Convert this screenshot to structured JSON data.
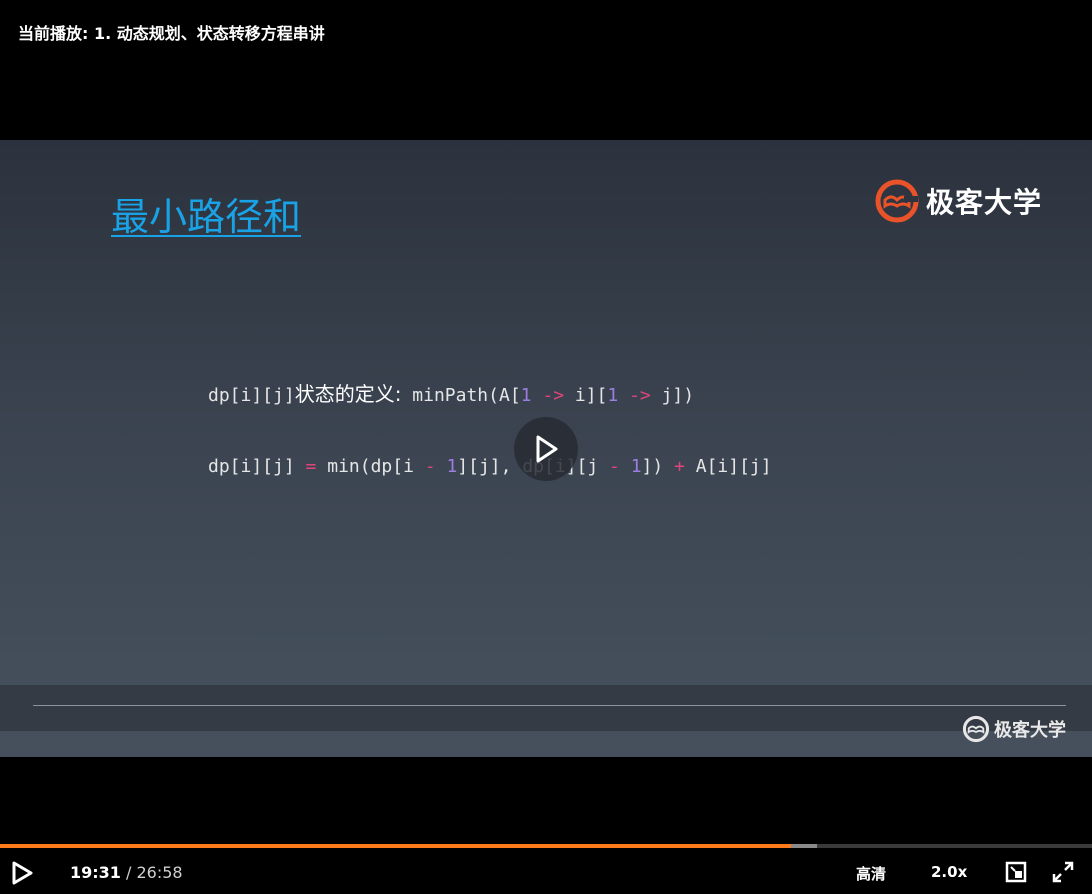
{
  "header": {
    "now_playing": "当前播放: 1. 动态规划、状态转移方程串讲"
  },
  "slide": {
    "title": "最小路径和",
    "brand": "极客大学",
    "footer_brand": "极客大学",
    "code": {
      "line1": {
        "lhs": "dp[i][j]",
        "label": "状态的定义:",
        "expr_a": " minPath(A[",
        "n1": "1",
        "arrow1": " -> ",
        "mid": "i][",
        "n2": "1",
        "arrow2": " -> ",
        "tail": "j])"
      },
      "line2": {
        "lhs": "dp[i][j] ",
        "eq": "=",
        "p1": " min(dp[i ",
        "minus1": "-",
        "sp1": " ",
        "one1": "1",
        "p2": "][j], dp[i][j ",
        "minus2": "-",
        "sp2": " ",
        "one2": "1",
        "p3": "]) ",
        "plus": "+",
        "p4": " A[i][j]"
      }
    }
  },
  "player": {
    "current_time": "19:31",
    "separator": " / ",
    "duration": "26:58",
    "quality": "高清",
    "speed": "2.0x",
    "progress_fraction": 0.724,
    "buffered_fraction": 0.748,
    "accent_color": "#ff7a1a"
  }
}
